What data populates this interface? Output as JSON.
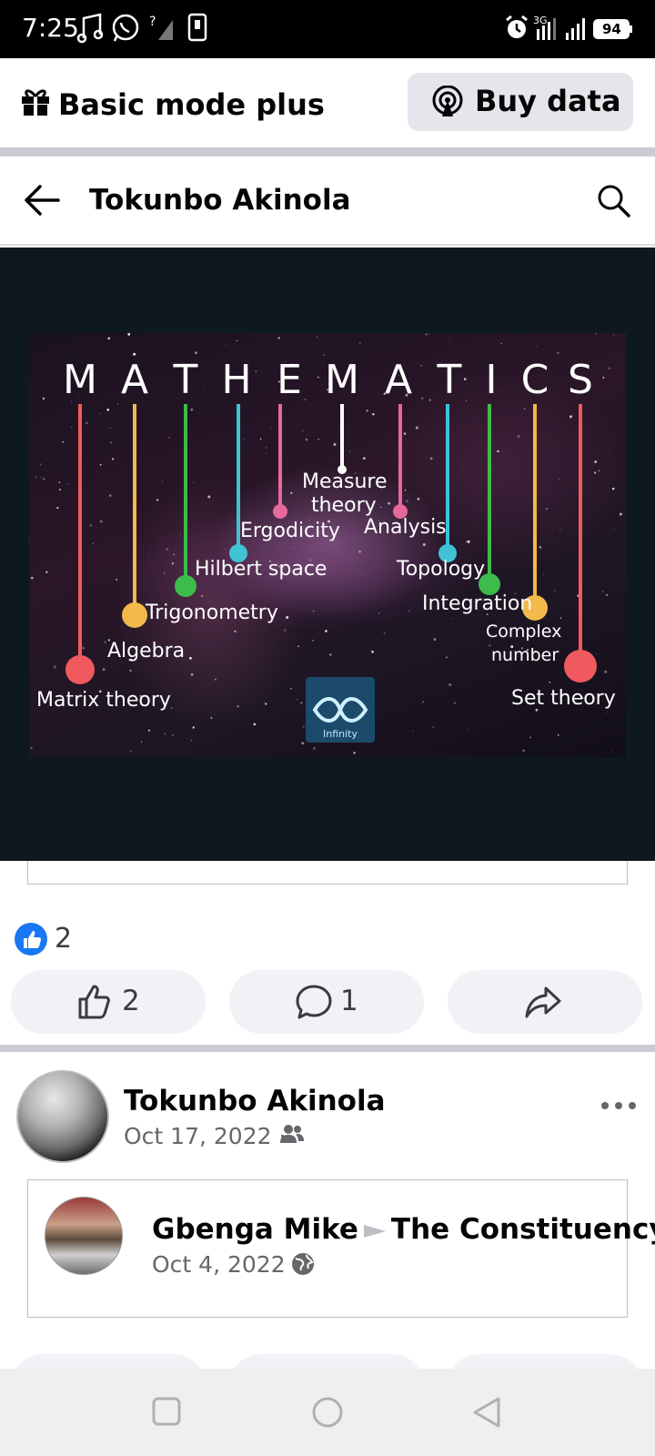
{
  "status_bar": {
    "time": "7:25",
    "battery": "94"
  },
  "mode_bar": {
    "label": "Basic mode plus",
    "buy_button": "Buy data"
  },
  "header": {
    "title": "Tokunbo Akinola"
  },
  "image": {
    "title_letters": [
      "M",
      "A",
      "T",
      "H",
      "E",
      "M",
      "A",
      "T",
      "I",
      "C",
      "S"
    ],
    "branches": [
      "Matrix theory",
      "Algebra",
      "Trigonometry",
      "Hilbert space",
      "Ergodicity",
      "Measure",
      "theory",
      "Analysis",
      "Topology",
      "Integration",
      "Complex",
      "number",
      "Set theory"
    ],
    "logo_text": "Infinity"
  },
  "reactions": {
    "count": "2",
    "like_count": "2",
    "comment_count": "1"
  },
  "post2": {
    "author": "Tokunbo Akinola",
    "date": "Oct 17, 2022",
    "separator": "·"
  },
  "shared_post": {
    "author": "Gbenga Mike",
    "target": "The Constituency",
    "date": "Oct 4, 2022",
    "separator": "·"
  }
}
